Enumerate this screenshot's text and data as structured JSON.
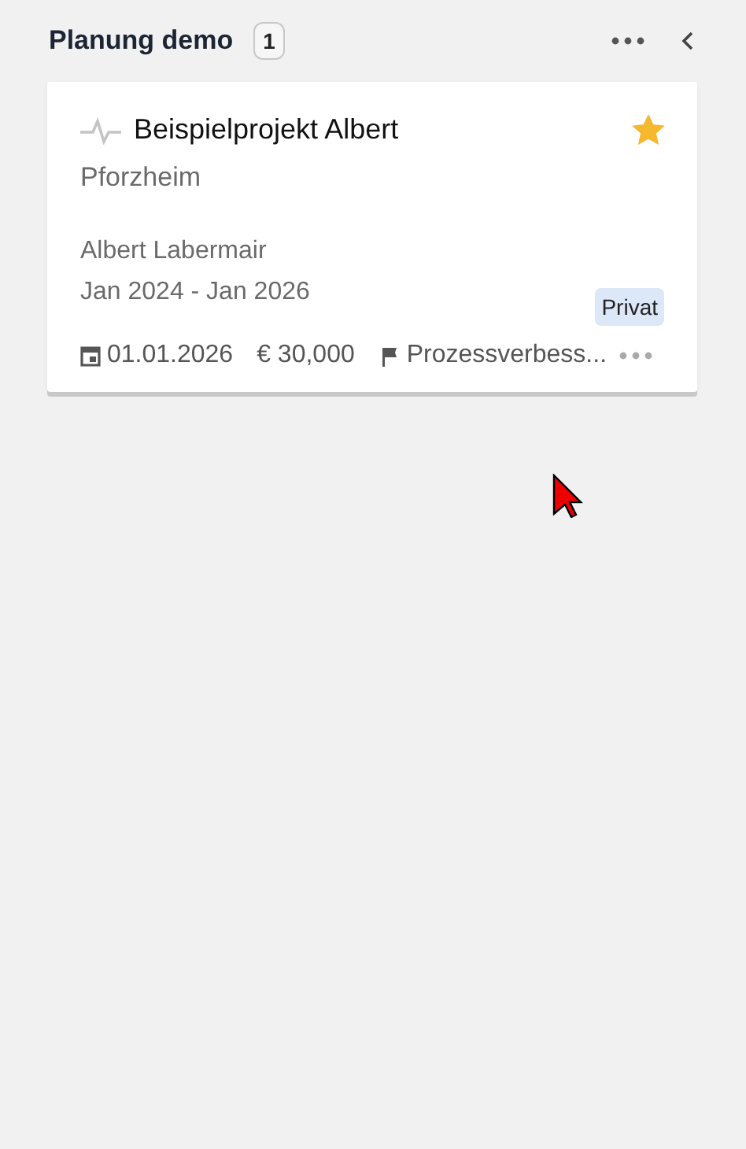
{
  "column": {
    "title": "Planung demo",
    "count": "1"
  },
  "cards": [
    {
      "title": "Beispielprojekt Albert",
      "starred": true,
      "location": "Pforzheim",
      "owner": "Albert Labermair",
      "period": "Jan 2024 - Jan 2026",
      "tag": "Privat",
      "due_date": "01.01.2026",
      "budget": "€ 30,000",
      "category": "Prozessverbess..."
    }
  ]
}
